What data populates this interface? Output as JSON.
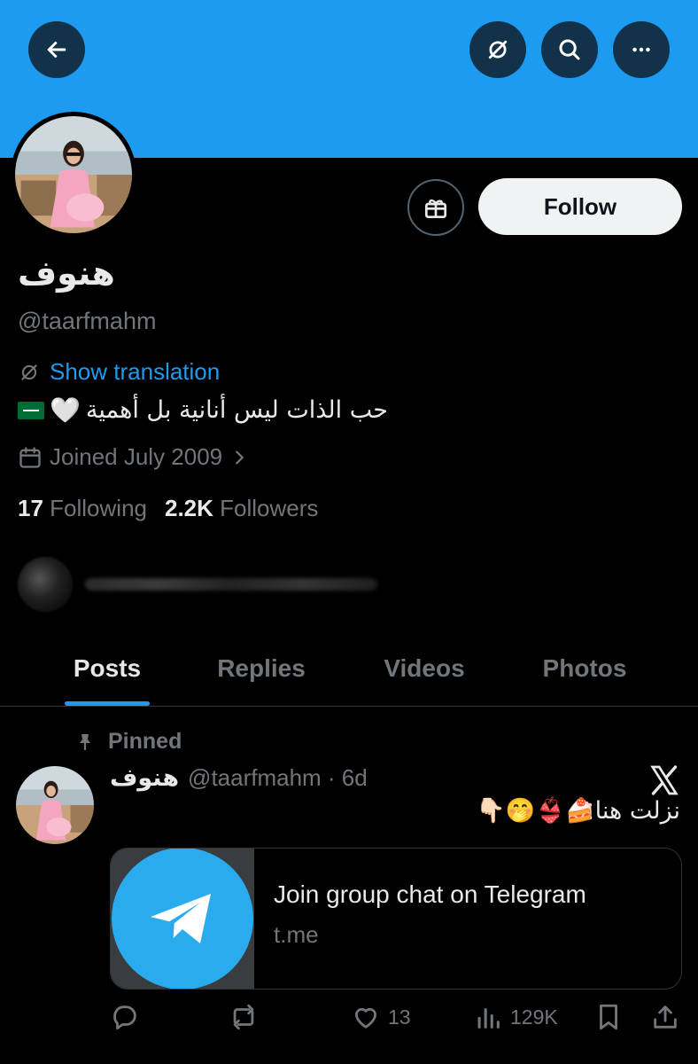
{
  "profile": {
    "display_name": "هنوف",
    "handle": "@taarfmahm",
    "translate_label": "Show translation",
    "bio_text": "حب الذات ليس أنانية بل أهمية",
    "bio_emoji": "🤍",
    "joined": "Joined July 2009",
    "following_count": "17",
    "following_label": "Following",
    "followers_count": "2.2K",
    "followers_label": "Followers",
    "follow_label": "Follow"
  },
  "tabs": [
    {
      "label": "Posts",
      "active": true
    },
    {
      "label": "Replies",
      "active": false
    },
    {
      "label": "Videos",
      "active": false
    },
    {
      "label": "Photos",
      "active": false
    }
  ],
  "post": {
    "pinned_label": "Pinned",
    "author_name": "هنوف",
    "author_meta": "@taarfmahm · 6d",
    "text": "نزلت هنا🍰👙🤭👇🏻",
    "card_title": "Join group chat on Telegram",
    "card_domain": "t.me",
    "likes": "13",
    "views": "129K"
  },
  "colors": {
    "banner": "#1d9bf0",
    "accent": "#1d9bf0",
    "telegram": "#2aabee"
  },
  "icons": [
    "back-arrow-icon",
    "translate-icon",
    "search-icon",
    "more-icon",
    "gift-icon",
    "calendar-icon",
    "chevron-right-icon",
    "pin-icon",
    "x-logo-icon",
    "telegram-icon",
    "reply-icon",
    "repost-icon",
    "like-icon",
    "views-icon",
    "bookmark-icon",
    "share-icon"
  ]
}
